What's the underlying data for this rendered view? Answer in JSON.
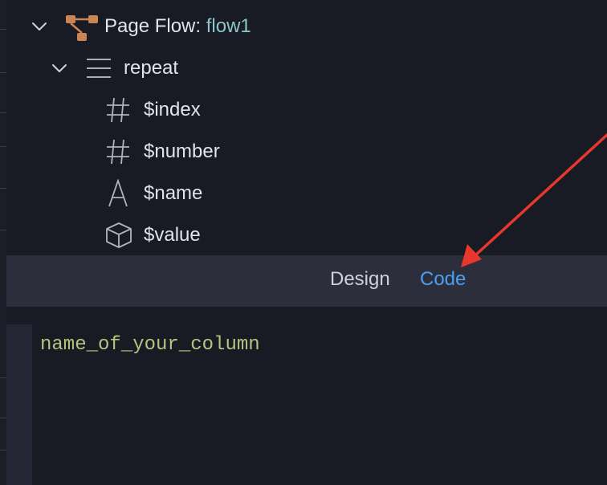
{
  "tree": {
    "root": {
      "label": "Page Flow: ",
      "name": "flow1"
    },
    "repeat": {
      "label": "repeat"
    },
    "vars": [
      {
        "icon": "hash-icon",
        "label": "$index"
      },
      {
        "icon": "hash-icon",
        "label": "$number"
      },
      {
        "icon": "text-type-icon",
        "label": "$name"
      },
      {
        "icon": "cube-icon",
        "label": "$value"
      }
    ]
  },
  "tabs": {
    "design": "Design",
    "code": "Code",
    "active": "Code"
  },
  "editor": {
    "code": "name_of_your_column"
  },
  "colors": {
    "accent_name": "#8fc7c9",
    "active_tab": "#4a9ff5",
    "code_text": "#b5c47e",
    "arrow": "#e8372c",
    "flow_icon": "#c98552"
  }
}
